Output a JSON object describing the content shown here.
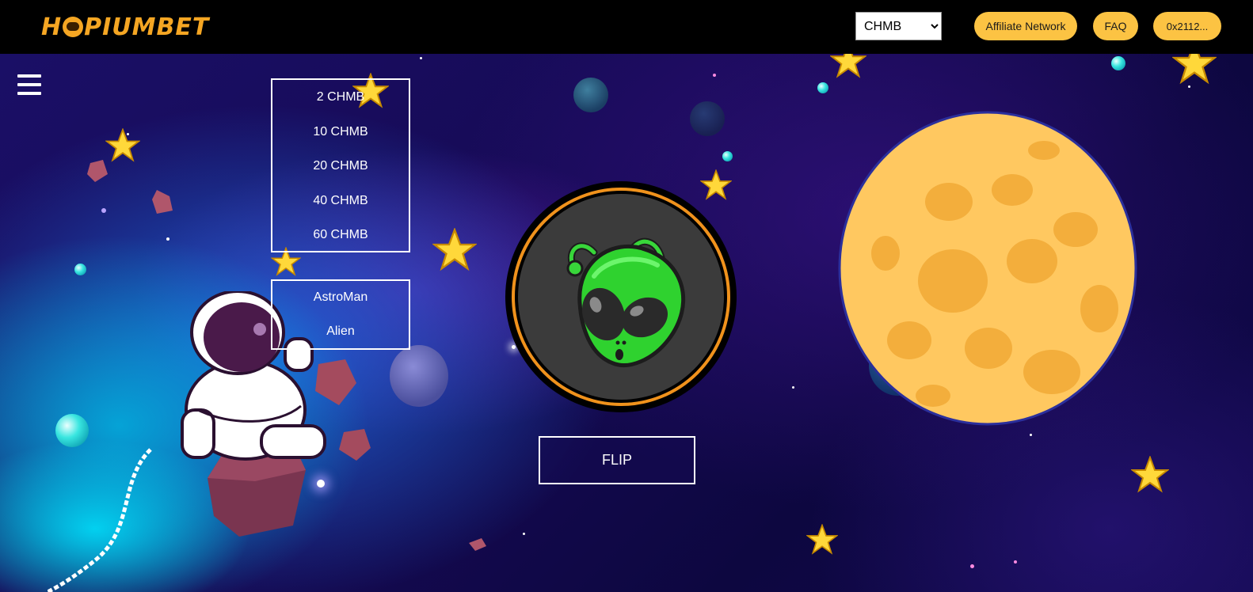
{
  "header": {
    "logo_text": "HOPIUMBET",
    "logo_parts": [
      "H",
      "PIUMBET"
    ],
    "currency_select": {
      "selected": "CHMB",
      "options": [
        "CHMB"
      ]
    },
    "affiliate_label": "Affiliate Network",
    "faq_label": "FAQ",
    "wallet_label": "0x2112..."
  },
  "bet_amounts": [
    "2 CHMB",
    "10 CHMB",
    "20 CHMB",
    "40 CHMB",
    "60 CHMB"
  ],
  "coin_sides": [
    "AstroMan",
    "Alien"
  ],
  "coin": {
    "face": "alien-icon",
    "ring_color": "#f0921c"
  },
  "flip_label": "FLIP",
  "colors": {
    "accent": "#fcc343",
    "logo": "#f5a623",
    "topbar": "#000000"
  }
}
